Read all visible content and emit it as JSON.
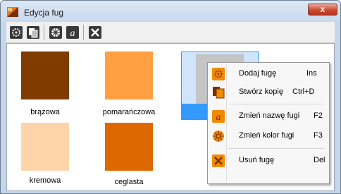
{
  "window": {
    "title": "Edycja fug",
    "close_label": "x"
  },
  "toolbar": {
    "buttons": [
      {
        "icon": "add-grout-icon"
      },
      {
        "icon": "copy-icon"
      },
      {
        "icon": "color-icon"
      },
      {
        "icon": "rename-icon"
      },
      {
        "icon": "delete-icon"
      }
    ]
  },
  "swatches": [
    {
      "label": "brązowa",
      "color": "#7f3b00"
    },
    {
      "label": "pomarańczowa",
      "color": "#ffa042"
    },
    {
      "label": "kremowa",
      "color": "#ffd4a8"
    },
    {
      "label": "ceglasta",
      "color": "#de6800"
    }
  ],
  "context_menu": {
    "items": [
      {
        "label": "Dodaj fugę",
        "shortcut": "Ins"
      },
      {
        "label": "Stwórz kopię",
        "shortcut": "Ctrl+D"
      },
      {
        "label": "Zmień nazwę fugi",
        "shortcut": "F2"
      },
      {
        "label": "Zmień kolor fugi",
        "shortcut": "F3"
      },
      {
        "label": "Usuń fugę",
        "shortcut": "Del"
      }
    ]
  },
  "colors": {
    "icon_orange": "#f08a00",
    "selection_blue": "#3399ff"
  }
}
